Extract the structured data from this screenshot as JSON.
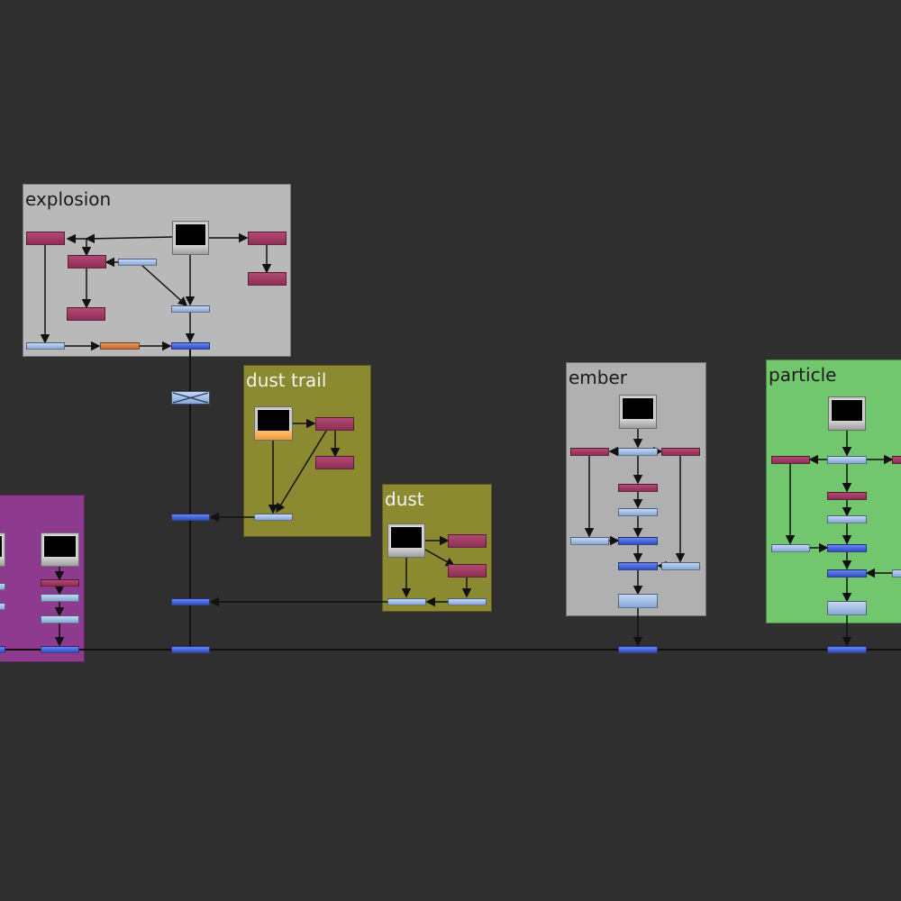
{
  "backdrops": {
    "explosion": {
      "label": "explosion",
      "color": "#b9b9b9",
      "text_color": "#1a1a1a"
    },
    "dust_trail": {
      "label": "dust trail",
      "color": "#8c8a30",
      "text_color": "#f2f2f2"
    },
    "dust": {
      "label": "dust",
      "color": "#8c8a30",
      "text_color": "#f2f2f2"
    },
    "ember": {
      "label": "ember",
      "color": "#b0b0b0",
      "text_color": "#1a1a1a"
    },
    "particle": {
      "label": "particle",
      "color": "#72c76e",
      "text_color": "#1a1a1a"
    },
    "purple": {
      "label": "",
      "color": "#8e3a8e",
      "text_color": "#f2f2f2"
    }
  },
  "colors": {
    "background": "#2f2f2f",
    "edge": "#111111",
    "node_maroon": "#9e3a62",
    "node_light_blue": "#a6bfe6",
    "node_blue": "#4a66dd",
    "node_orange": "#d27a3a"
  },
  "icons": {
    "viewer": "viewer-monitor-icon",
    "switch": "switch-x-icon"
  }
}
